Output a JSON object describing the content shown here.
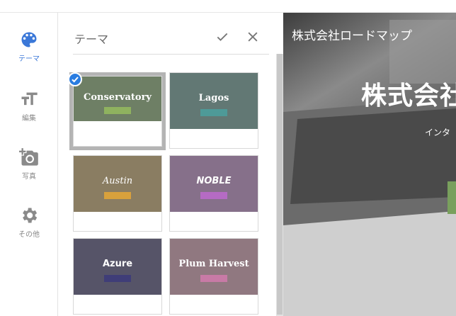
{
  "rail": {
    "items": [
      {
        "label": "テーマ",
        "icon": "palette-icon",
        "active": true
      },
      {
        "label": "編集",
        "icon": "text-size-icon",
        "active": false
      },
      {
        "label": "写真",
        "icon": "add-photo-icon",
        "active": false
      },
      {
        "label": "その他",
        "icon": "gear-icon",
        "active": false
      }
    ]
  },
  "panel": {
    "title": "テーマ",
    "confirm_icon": "check-icon",
    "close_icon": "close-icon",
    "themes": [
      {
        "name": "Conservatory",
        "bg": "#6e7f65",
        "accent": "#8fb25f",
        "selected": true
      },
      {
        "name": "Lagos",
        "bg": "#627874",
        "accent": "#4e9a98",
        "selected": false
      },
      {
        "name": "Austin",
        "bg": "#8a7d62",
        "accent": "#d8a13c",
        "selected": false
      },
      {
        "name": "NOBLE",
        "bg": "#86708a",
        "accent": "#b56bc4",
        "selected": false
      },
      {
        "name": "Azure",
        "bg": "#565468",
        "accent": "#3f3d78",
        "selected": false
      },
      {
        "name": "Plum Harvest",
        "bg": "#907880",
        "accent": "#c87aa6",
        "selected": false
      }
    ]
  },
  "preview": {
    "site_title": "株式会社ロードマップ",
    "hero": "株式会社",
    "sub": "インタ"
  },
  "colors": {
    "accent_blue": "#2a7de1",
    "selected_frame": "#b4b4b4"
  }
}
